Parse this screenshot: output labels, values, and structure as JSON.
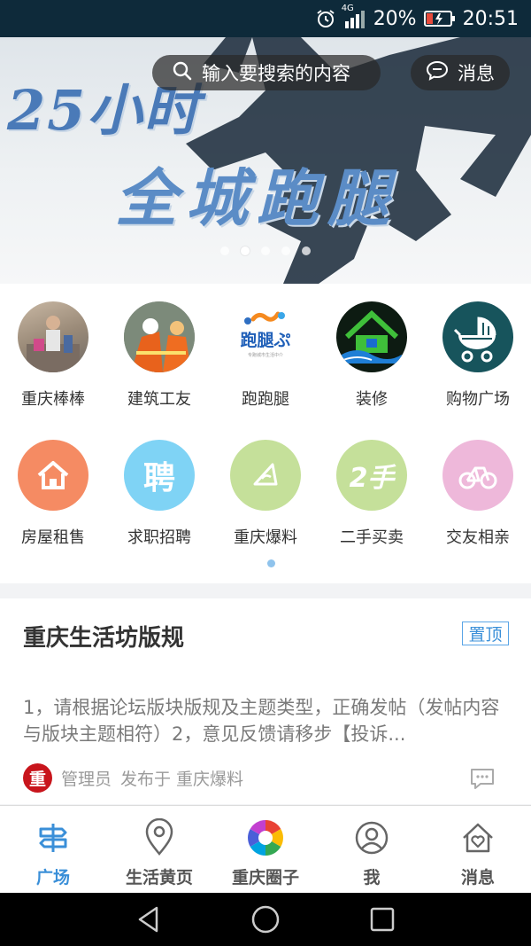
{
  "status_bar": {
    "network": "4G",
    "battery": "20%",
    "time": "20:51"
  },
  "search": {
    "placeholder": "输入要搜索的内容"
  },
  "message_button": {
    "label": "消息"
  },
  "banner": {
    "headline_line1": "25小时",
    "headline_line2": "全城跑腿",
    "active_slide": 2,
    "slide_count": 5
  },
  "categories": [
    {
      "label": "重庆棒棒",
      "icon": "porter-photo"
    },
    {
      "label": "建筑工友",
      "icon": "construction-workers-photo"
    },
    {
      "label": "跑跑腿",
      "icon": "errand-runner-logo"
    },
    {
      "label": "装修",
      "icon": "house-renovation-icon"
    },
    {
      "label": "购物广场",
      "icon": "stroller-icon"
    },
    {
      "label": "房屋租售",
      "icon": "house-icon",
      "color": "#f58b63"
    },
    {
      "label": "求职招聘",
      "icon": "recruit-icon",
      "color": "#7fd3f5"
    },
    {
      "label": "重庆爆料",
      "icon": "megaphone-icon",
      "color": "#c5e09a"
    },
    {
      "label": "二手买卖",
      "icon": "second-hand-icon",
      "color": "#c5e09a"
    },
    {
      "label": "交友相亲",
      "icon": "bicycle-icon",
      "color": "#eeb8da"
    }
  ],
  "post": {
    "title": "重庆生活坊版规",
    "badge": "置顶",
    "body": "1，请根据论坛版块版规及主题类型，正确发帖（发帖内容与版块主题相符）2，意见反馈请移步【投诉...",
    "avatar_text": "重",
    "author": "管理员",
    "published_in": "发布于 重庆爆料"
  },
  "tabs": [
    {
      "label": "广场",
      "icon": "signpost-icon",
      "active": true
    },
    {
      "label": "生活黄页",
      "icon": "location-pin-icon",
      "active": false
    },
    {
      "label": "重庆圈子",
      "icon": "aperture-icon",
      "active": false
    },
    {
      "label": "我",
      "icon": "user-icon",
      "active": false
    },
    {
      "label": "消息",
      "icon": "home-heart-icon",
      "active": false
    }
  ],
  "colors": {
    "accent": "#3a8fd8",
    "status_bar": "#0e2a3a"
  }
}
